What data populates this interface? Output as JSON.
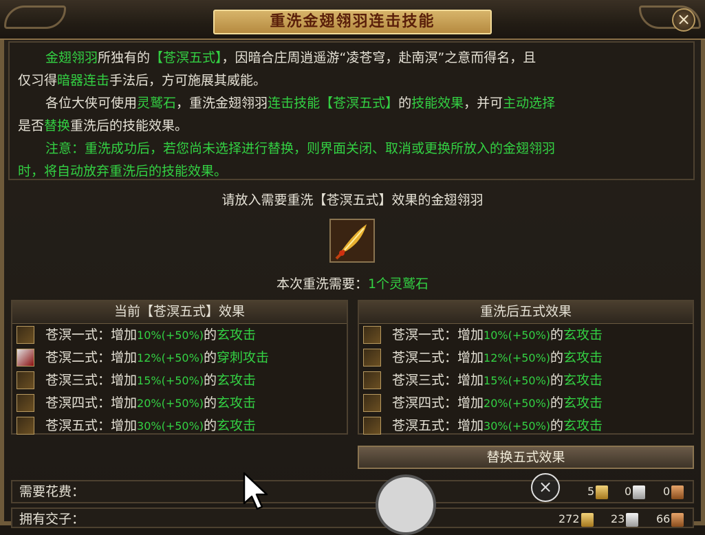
{
  "window": {
    "title": "重洗金翅翎羽连击技能",
    "close_label": "×"
  },
  "description": {
    "p1": {
      "item": "金翅翎羽",
      "t1": "所独有的",
      "skill": "【苍溟五式】",
      "t2": "，因暗合庄周逍遥游“凌苍穹，赴南溟”之意而得名，且",
      "t3": "仅习得",
      "hidden": "暗器连击",
      "t4": "手法后，方可施展其威能。"
    },
    "p2": {
      "t1": "各位大侠可使用",
      "stone": "灵鹫石",
      "t2": "，重洗",
      "item": "金翅翎羽",
      "combo": "连击技能【苍溟五式】",
      "t3": "的",
      "effect": "技能效果",
      "t4": "，并可",
      "choose": "主动选择",
      "t5": "是否",
      "replace": "替换",
      "t6": "重洗后的技能效果。"
    },
    "p3": "注意：重洗成功后，若您尚未选择进行替换，则界面关闭、取消或更换所放入的金翅翎羽",
    "p3b": "时，将自动放弃重洗后的技能效果。"
  },
  "prompt": "请放入需要重洗【苍溟五式】效果的金翅翎羽",
  "cost": {
    "label": "本次重洗需要：",
    "count": "1个",
    "item": "灵鹫石"
  },
  "current_panel": {
    "header": "当前【苍溟五式】效果",
    "rows": [
      {
        "name": "苍溟一式：增加",
        "pct": "10%(+50%)",
        "of": "的",
        "effect": "玄攻击"
      },
      {
        "name": "苍溟二式：增加",
        "pct": "12%(+50%)",
        "of": "的",
        "effect": "穿刺攻击"
      },
      {
        "name": "苍溟三式：增加",
        "pct": "15%(+50%)",
        "of": "的",
        "effect": "玄攻击"
      },
      {
        "name": "苍溟四式：增加",
        "pct": "20%(+50%)",
        "of": "的",
        "effect": "玄攻击"
      },
      {
        "name": "苍溟五式：增加",
        "pct": "30%(+50%)",
        "of": "的",
        "effect": "玄攻击"
      }
    ]
  },
  "new_panel": {
    "header": "重洗后五式效果",
    "rows": [
      {
        "name": "苍溟一式：增加",
        "pct": "10%(+50%)",
        "of": "的",
        "effect": "玄攻击"
      },
      {
        "name": "苍溟二式：增加",
        "pct": "12%(+50%)",
        "of": "的",
        "effect": "玄攻击"
      },
      {
        "name": "苍溟三式：增加",
        "pct": "15%(+50%)",
        "of": "的",
        "effect": "玄攻击"
      },
      {
        "name": "苍溟四式：增加",
        "pct": "20%(+50%)",
        "of": "的",
        "effect": "玄攻击"
      },
      {
        "name": "苍溟五式：增加",
        "pct": "30%(+50%)",
        "of": "的",
        "effect": "玄攻击"
      }
    ]
  },
  "replace_button": "替换五式效果",
  "spend": {
    "label": "需要花费：",
    "gold": "5",
    "silver": "0",
    "bronze": "0"
  },
  "owned": {
    "label": "拥有交子：",
    "gold": "272",
    "silver": "23",
    "bronze": "66"
  },
  "icons": {
    "close": "close-icon",
    "skill": "skill-icon",
    "feather": "feather-item-icon",
    "gold": "gold-ingot-icon",
    "silver": "silver-ingot-icon",
    "bronze": "bronze-ingot-icon"
  },
  "colors": {
    "highlight_green": "#33d143",
    "title_gold": "#d7b46a"
  }
}
